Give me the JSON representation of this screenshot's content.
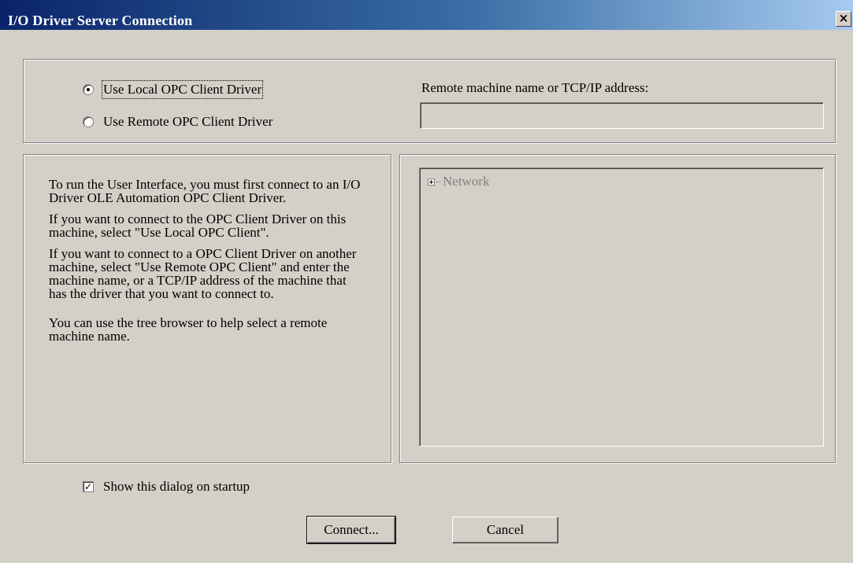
{
  "window": {
    "title": "I/O Driver Server Connection",
    "close_label": "×"
  },
  "connection": {
    "local_label": "Use Local OPC Client Driver",
    "remote_label": "Use Remote OPC Client Driver",
    "selected": "local",
    "remote_address_label": "Remote machine name or TCP/IP address:",
    "remote_address_value": ""
  },
  "help": {
    "paragraph1": "To run the User Interface, you must first connect to an  I/O Driver OLE Automation OPC Client Driver.",
    "paragraph2": "If you want to connect to the OPC Client Driver on this machine, select \"Use Local OPC Client\".",
    "paragraph3": "If you want to connect to a OPC Client Driver on another machine, select \"Use Remote OPC Client\" and enter the machine name, or a TCP/IP address of the machine that has the driver that you want to connect to.",
    "paragraph4": "You can use the tree browser to help select a remote machine name."
  },
  "tree": {
    "root_label": "Network"
  },
  "startup": {
    "label": "Show this dialog on startup",
    "checked": true
  },
  "buttons": {
    "connect_label": "Connect...",
    "cancel_label": "Cancel"
  }
}
